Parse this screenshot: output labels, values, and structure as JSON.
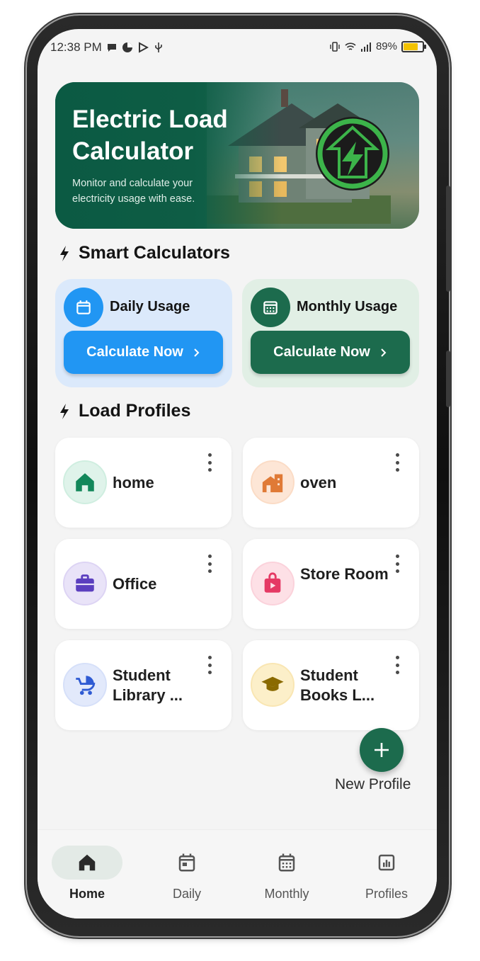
{
  "status_bar": {
    "time": "12:38 PM",
    "battery": "89%"
  },
  "hero": {
    "title": "Electric Load Calculator",
    "subtitle": "Monitor and calculate your electricity usage with ease."
  },
  "smart_calculators": {
    "heading": "Smart Calculators",
    "daily": {
      "title": "Daily Usage",
      "button": "Calculate Now",
      "icon": "calendar-icon",
      "color": "#2196f3"
    },
    "monthly": {
      "title": "Monthly Usage",
      "button": "Calculate Now",
      "icon": "calendar-month-icon",
      "color": "#1c6b4d"
    }
  },
  "load_profiles": {
    "heading": "Load Profiles",
    "items": [
      {
        "name": "home",
        "icon": "house-icon",
        "color": "#12875a"
      },
      {
        "name": "oven",
        "icon": "building-icon",
        "color": "#e07a36"
      },
      {
        "name": "Office",
        "icon": "briefcase-icon",
        "color": "#5b3fbf"
      },
      {
        "name": "Store Room",
        "icon": "shopping-bag-icon",
        "color": "#e53964"
      },
      {
        "name": "Student Library ...",
        "icon": "stroller-icon",
        "color": "#2f5bd3"
      },
      {
        "name": "Student Books L...",
        "icon": "graduation-cap-icon",
        "color": "#8a6a00"
      }
    ]
  },
  "fab": {
    "label": "New Profile",
    "icon": "plus-icon"
  },
  "bottom_nav": {
    "items": [
      {
        "label": "Home",
        "icon": "home-icon",
        "active": true
      },
      {
        "label": "Daily",
        "icon": "calendar-icon",
        "active": false
      },
      {
        "label": "Monthly",
        "icon": "calendar-month-icon",
        "active": false
      },
      {
        "label": "Profiles",
        "icon": "bar-chart-icon",
        "active": false
      }
    ]
  }
}
